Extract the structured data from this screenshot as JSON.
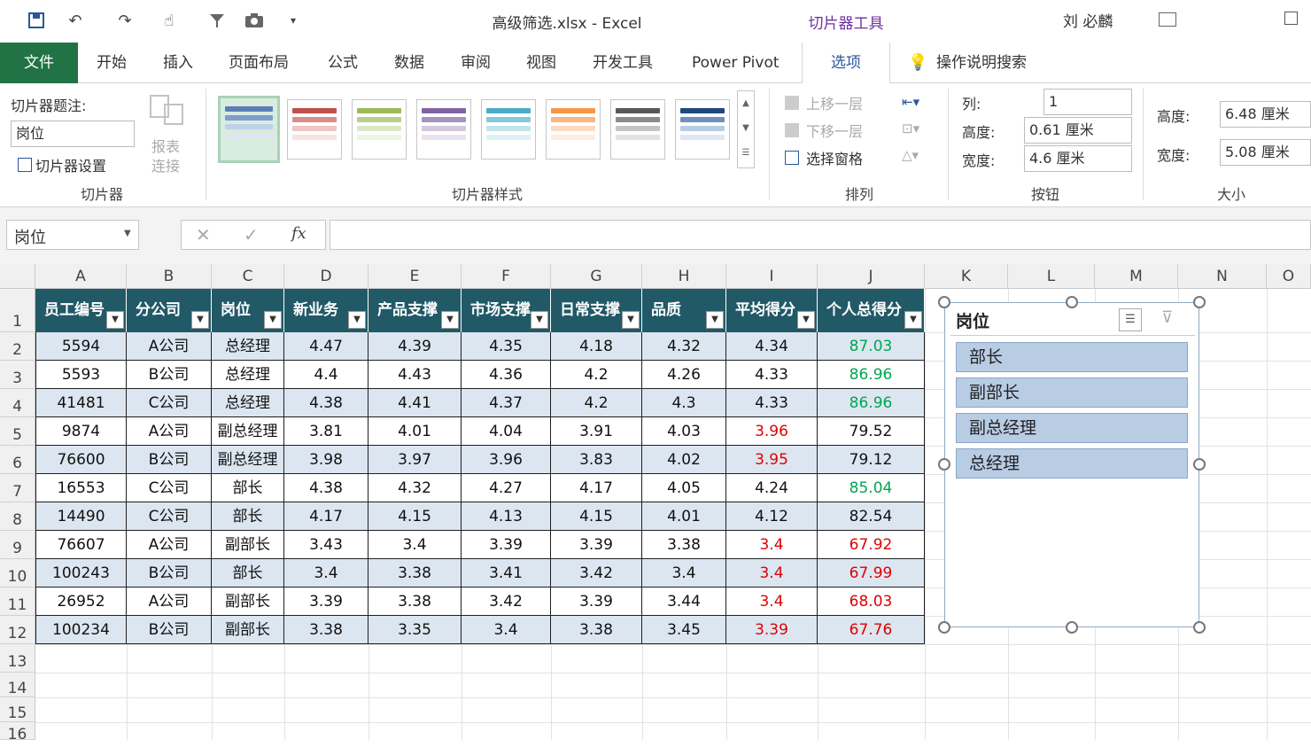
{
  "title_bar": {
    "doc_title": "高级筛选.xlsx  -  Excel",
    "context_title": "切片器工具",
    "user": "刘 必麟"
  },
  "tabs": [
    "文件",
    "开始",
    "插入",
    "页面布局",
    "公式",
    "数据",
    "审阅",
    "视图",
    "开发工具",
    "Power Pivot",
    "选项",
    "操作说明搜索"
  ],
  "ribbon": {
    "slicer_group": {
      "caption_label": "切片器题注:",
      "caption_value": "岗位",
      "settings": "切片器设置",
      "report_conn_1": "报表",
      "report_conn_2": "连接",
      "group_label": "切片器"
    },
    "styles_group": {
      "group_label": "切片器样式"
    },
    "arrange_group": {
      "bring_forward": "上移一层",
      "send_backward": "下移一层",
      "selection_pane": "选择窗格",
      "group_label": "排列"
    },
    "buttons_group": {
      "columns_label": "列:",
      "columns_value": "1",
      "height_label": "高度:",
      "height_value": "0.61 厘米",
      "width_label": "宽度:",
      "width_value": "4.6 厘米",
      "group_label": "按钮"
    },
    "size_group": {
      "height_label": "高度:",
      "height_value": "6.48 厘米",
      "width_label": "宽度:",
      "width_value": "5.08 厘米",
      "group_label": "大小"
    }
  },
  "formula_bar": {
    "name_box": "岗位",
    "fx": "fx",
    "formula": ""
  },
  "columns": [
    "A",
    "B",
    "C",
    "D",
    "E",
    "F",
    "G",
    "H",
    "I",
    "J",
    "K",
    "L",
    "M",
    "N",
    "O"
  ],
  "rows": [
    "1",
    "2",
    "3",
    "4",
    "5",
    "6",
    "7",
    "8",
    "9",
    "10",
    "11",
    "12",
    "13",
    "14",
    "15",
    "16"
  ],
  "table": {
    "headers": [
      "员工编号",
      "分公司",
      "岗位",
      "新业务",
      "产品支撑",
      "市场支撑",
      "日常支撑",
      "品质",
      "平均得分",
      "个人总得分"
    ],
    "rows": [
      [
        "5594",
        "A公司",
        "总经理",
        "4.47",
        "4.39",
        "4.35",
        "4.18",
        "4.32",
        "4.34",
        "87.03"
      ],
      [
        "5593",
        "B公司",
        "总经理",
        "4.4",
        "4.43",
        "4.36",
        "4.2",
        "4.26",
        "4.33",
        "86.96"
      ],
      [
        "41481",
        "C公司",
        "总经理",
        "4.38",
        "4.41",
        "4.37",
        "4.2",
        "4.3",
        "4.33",
        "86.96"
      ],
      [
        "9874",
        "A公司",
        "副总经理",
        "3.81",
        "4.01",
        "4.04",
        "3.91",
        "4.03",
        "3.96",
        "79.52"
      ],
      [
        "76600",
        "B公司",
        "副总经理",
        "3.98",
        "3.97",
        "3.96",
        "3.83",
        "4.02",
        "3.95",
        "79.12"
      ],
      [
        "16553",
        "C公司",
        "部长",
        "4.38",
        "4.32",
        "4.27",
        "4.17",
        "4.05",
        "4.24",
        "85.04"
      ],
      [
        "14490",
        "C公司",
        "部长",
        "4.17",
        "4.15",
        "4.13",
        "4.15",
        "4.01",
        "4.12",
        "82.54"
      ],
      [
        "76607",
        "A公司",
        "副部长",
        "3.43",
        "3.4",
        "3.39",
        "3.39",
        "3.38",
        "3.4",
        "67.92"
      ],
      [
        "100243",
        "B公司",
        "部长",
        "3.4",
        "3.38",
        "3.41",
        "3.42",
        "3.4",
        "3.4",
        "67.99"
      ],
      [
        "26952",
        "A公司",
        "副部长",
        "3.39",
        "3.38",
        "3.42",
        "3.39",
        "3.44",
        "3.4",
        "68.03"
      ],
      [
        "100234",
        "B公司",
        "副部长",
        "3.38",
        "3.35",
        "3.4",
        "3.38",
        "3.45",
        "3.39",
        "67.76"
      ]
    ],
    "avg_red": [
      false,
      false,
      false,
      true,
      true,
      false,
      false,
      true,
      true,
      true,
      true
    ],
    "total_color": [
      "green",
      "green",
      "green",
      "black",
      "black",
      "green",
      "black",
      "red",
      "red",
      "red",
      "red"
    ]
  },
  "slicer": {
    "title": "岗位",
    "items": [
      "部长",
      "副部长",
      "副总经理",
      "总经理"
    ]
  },
  "colors": {
    "green": "#00a650",
    "red": "#e00000",
    "header_bg": "#215967",
    "band": "#dce6f1",
    "slicer_item": "#b8cce4"
  }
}
